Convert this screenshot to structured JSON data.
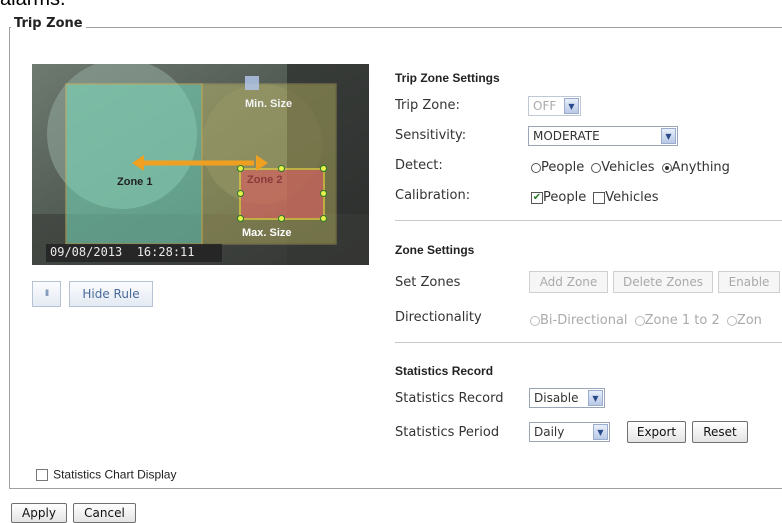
{
  "cut_text": "alarms.",
  "section": {
    "legend": "Trip Zone"
  },
  "camera": {
    "timestamp": "09/08/2013  16:28:11",
    "min_size": "Min. Size",
    "max_size": "Max. Size",
    "zone1": "Zone 1",
    "zone2": "Zone 2"
  },
  "camera_controls": {
    "pause_icon": "pause-icon",
    "pause_glyph": "II",
    "hide_rule": "Hide Rule"
  },
  "trip_zone_settings": {
    "header": "Trip Zone Settings",
    "trip_zone_label": "Trip Zone:",
    "trip_zone_value": "OFF",
    "sensitivity_label": "Sensitivity:",
    "sensitivity_value": "MODERATE",
    "detect_label": "Detect:",
    "detect_options": [
      "People",
      "Vehicles",
      "Anything"
    ],
    "detect_selected": "Anything",
    "calibration_label": "Calibration:",
    "calibration_options": [
      "People",
      "Vehicles"
    ],
    "calibration_checked": [
      "People"
    ]
  },
  "zone_settings": {
    "header": "Zone Settings",
    "set_zones_label": "Set Zones",
    "add_zone": "Add Zone",
    "delete_zones": "Delete Zones",
    "enable": "Enable",
    "directionality_label": "Directionality",
    "directionality_options": [
      "Bi-Directional",
      "Zone 1 to 2",
      "Zon"
    ]
  },
  "statistics": {
    "header": "Statistics Record",
    "record_label": "Statistics Record",
    "record_value": "Disable",
    "period_label": "Statistics Period",
    "period_value": "Daily",
    "export": "Export",
    "reset": "Reset"
  },
  "chart_display": {
    "label": "Statistics Chart Display",
    "checked": false
  },
  "footer": {
    "apply": "Apply",
    "cancel": "Cancel"
  },
  "colors": {
    "link_blue": "#4a6a99",
    "zone_yellow": "#e8e070",
    "zone_red": "#d86060",
    "arrow": "#f0a020"
  }
}
